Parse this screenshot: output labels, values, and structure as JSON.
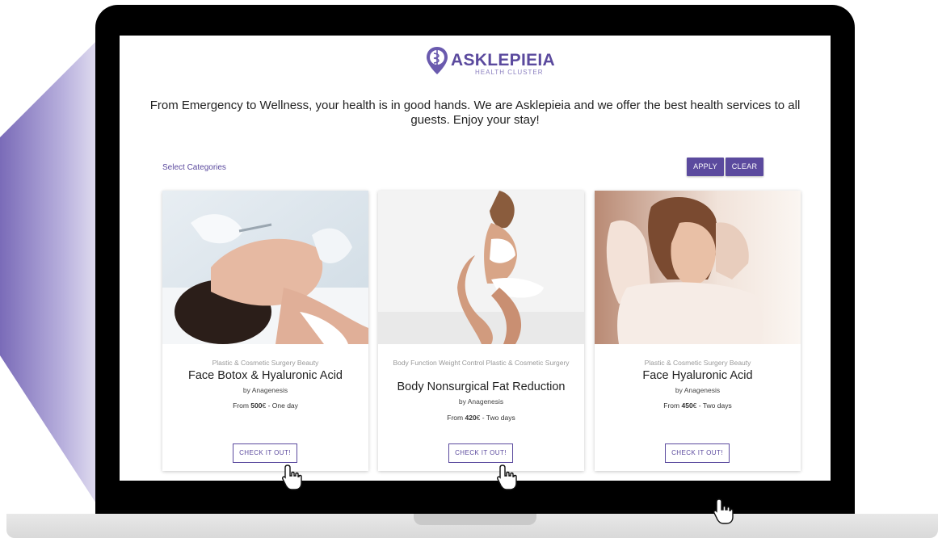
{
  "brand": {
    "name": "ASKLEPIEIA",
    "subtitle": "HEALTH CLUSTER",
    "color": "#5b4a9e"
  },
  "tagline": "From Emergency to Wellness, your health is in good hands. We are Asklepieia and we offer the best health services to all guests. Enjoy your stay!",
  "filters": {
    "select_label": "Select Categories",
    "apply_label": "APPLY",
    "clear_label": "CLEAR"
  },
  "cards": [
    {
      "categories": "Plastic & Cosmetic Surgery Beauty",
      "title": "Face Botox & Hyaluronic Acid",
      "provider": "by Anagenesis",
      "price_prefix": "From ",
      "price": "500",
      "price_suffix": "€ - One day",
      "cta": "CHECK IT OUT!",
      "image": "woman-face-injection-photo"
    },
    {
      "categories": "Body Function Weight Control Plastic & Cosmetic Surgery",
      "title": "Body Nonsurgical Fat Reduction",
      "provider": "by Anagenesis",
      "price_prefix": "From ",
      "price": "420",
      "price_suffix": "€ - Two days",
      "cta": "CHECK IT OUT!",
      "image": "woman-sitting-body-photo"
    },
    {
      "categories": "Plastic & Cosmetic Surgery Beauty",
      "title": "Face Hyaluronic Acid",
      "provider": "by Anagenesis",
      "price_prefix": "From ",
      "price": "450",
      "price_suffix": "€ - Two days",
      "cta": "CHECK IT OUT!",
      "image": "woman-portrait-photo"
    }
  ],
  "icons": {
    "cursor": "hand-pointer-icon",
    "logo": "caduceus-pin-icon"
  }
}
